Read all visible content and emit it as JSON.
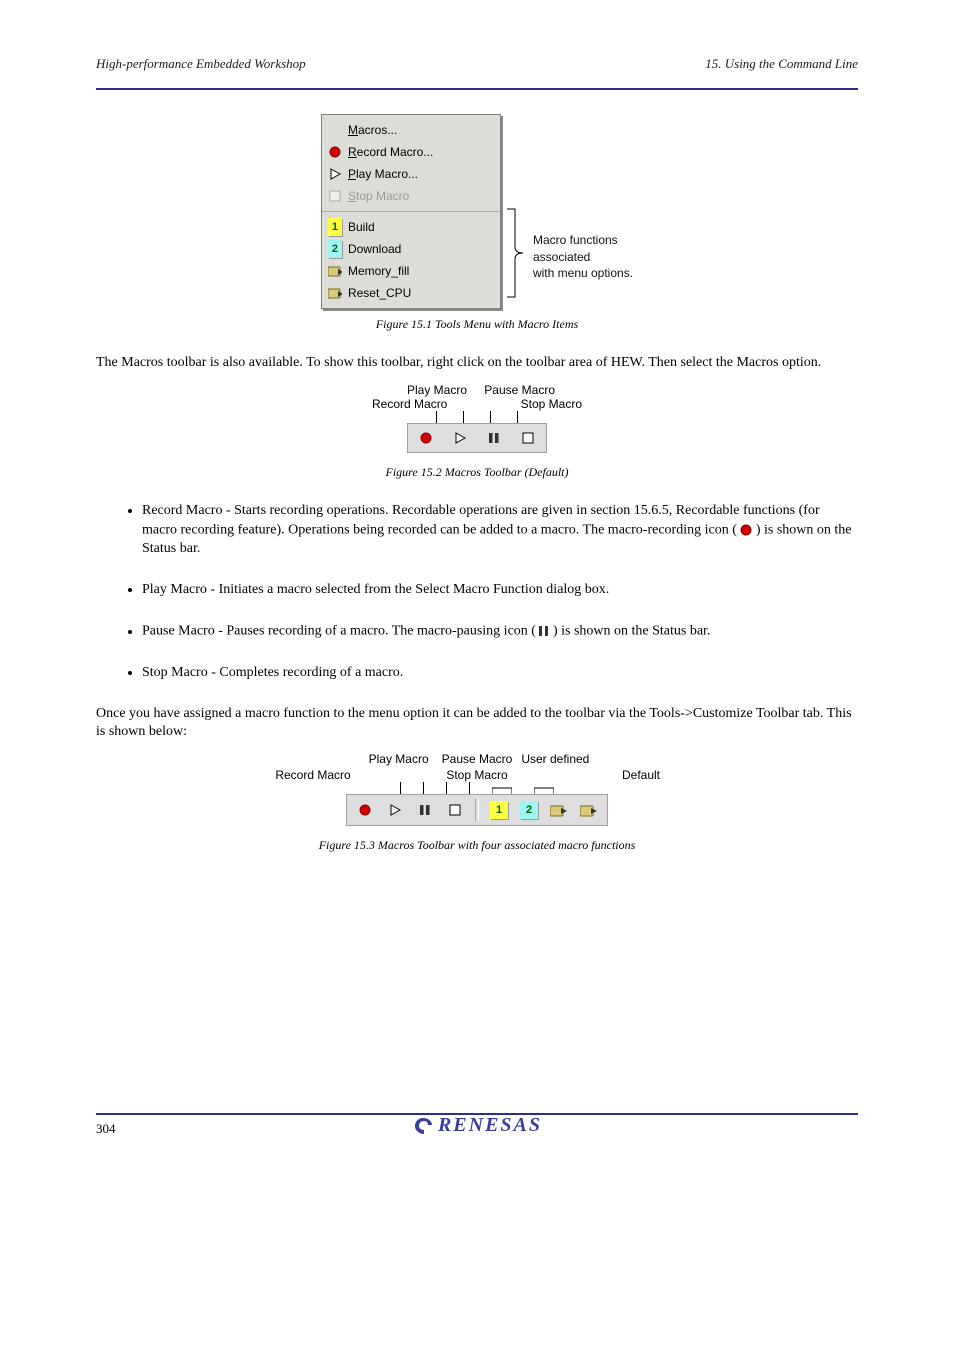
{
  "header": {
    "left": "High-performance Embedded Workshop",
    "right": "15. Using the Command Line"
  },
  "fig1": {
    "menu": {
      "macros": "Macros...",
      "record": "Record Macro...",
      "play": "Play Macro...",
      "stop": "Stop Macro",
      "items": [
        "Build",
        "Download",
        "Memory_fill",
        "Reset_CPU"
      ]
    },
    "note_l1": "Macro functions",
    "note_l2": "associated",
    "note_l3": "with menu options.",
    "caption": "Figure 15.1 Tools Menu with Macro Items"
  },
  "para_after_fig1": "The Macros toolbar is also available. To show this toolbar, right click on the toolbar area of HEW. Then select the Macros option.",
  "toolbar1": {
    "top_left": "Record Macro",
    "top_center": "Play Macro",
    "top_right1": "Pause Macro",
    "top_right2": "Stop Macro",
    "caption": "Figure 15.2 Macros Toolbar (Default)"
  },
  "bullets": {
    "b1_a": "Record Macro - Starts recording operations. Recordable operations are given in section 15.6.5, Recordable functions (for macro recording feature).",
    "b1_b": "Operations being recorded can be added to a macro. The macro-recording icon (",
    "b1_c": ") is shown on the Status bar.",
    "b2": "Play Macro - Initiates a macro selected from the Select Macro Function dialog box.",
    "b3": "Pause Macro - Pauses recording of a macro. The macro-pausing icon (",
    "b3_b": ") is shown on the Status bar.",
    "b4": "Stop Macro - Completes recording of a macro."
  },
  "para_after_bullets": "Once you have assigned a macro function to the menu option it can be added to the toolbar via the Tools->Customize Toolbar tab. This is shown below:",
  "toolbar2": {
    "row1": {
      "a": "Play Macro",
      "b": "Pause Macro",
      "c": "User defined"
    },
    "row2": {
      "a": "Record Macro",
      "b": "Stop Macro",
      "c": "Default"
    },
    "caption": "Figure 15.3 Macros Toolbar with four associated macro functions"
  },
  "footer": {
    "page": "304",
    "logo": "RENESAS"
  }
}
